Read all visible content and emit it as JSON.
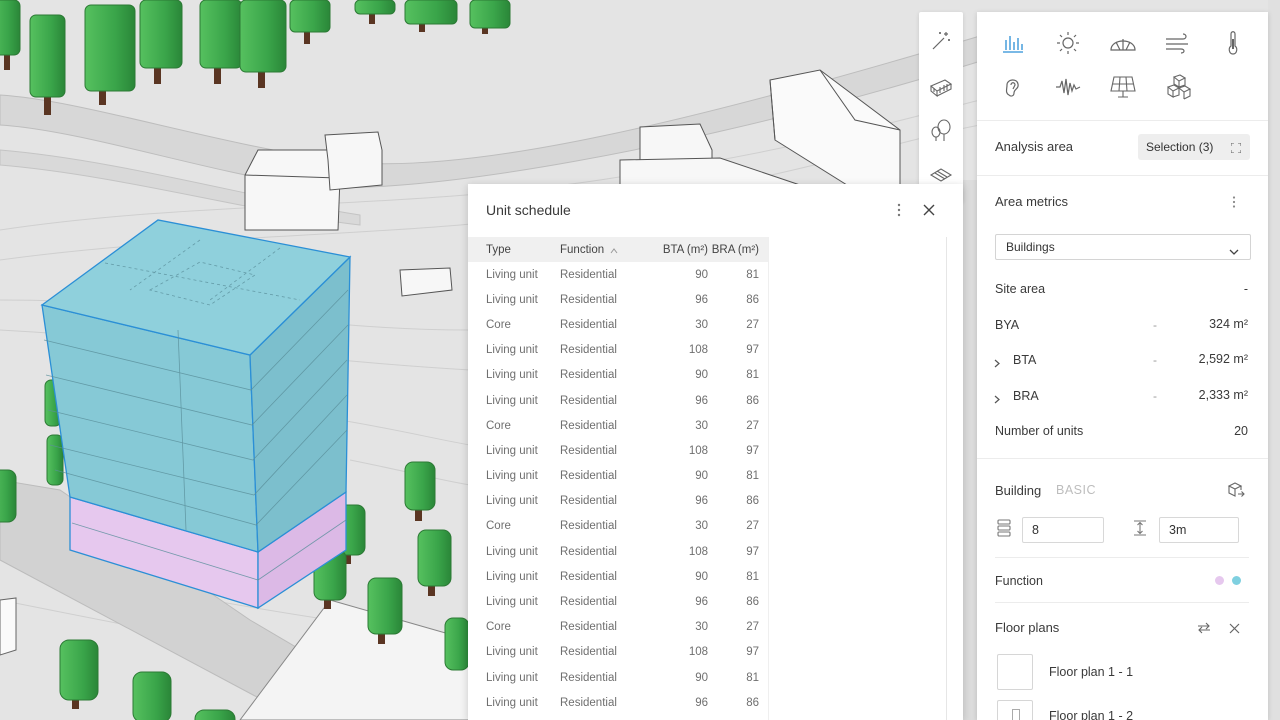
{
  "toolbar": {
    "tools": [
      {
        "icon": "magic-wand-icon"
      },
      {
        "icon": "building-block-icon"
      },
      {
        "icon": "trees-icon"
      },
      {
        "icon": "plane-icon"
      }
    ]
  },
  "unit_schedule": {
    "title": "Unit schedule",
    "columns": {
      "type": "Type",
      "function": "Function",
      "bta": "BTA (m²)",
      "bra": "BRA (m²)"
    },
    "sort_indicator": "^",
    "rows": [
      {
        "type": "Living unit",
        "function": "Residential",
        "bta": "90",
        "bra": "81"
      },
      {
        "type": "Living unit",
        "function": "Residential",
        "bta": "96",
        "bra": "86"
      },
      {
        "type": "Core",
        "function": "Residential",
        "bta": "30",
        "bra": "27"
      },
      {
        "type": "Living unit",
        "function": "Residential",
        "bta": "108",
        "bra": "97"
      },
      {
        "type": "Living unit",
        "function": "Residential",
        "bta": "90",
        "bra": "81"
      },
      {
        "type": "Living unit",
        "function": "Residential",
        "bta": "96",
        "bra": "86"
      },
      {
        "type": "Core",
        "function": "Residential",
        "bta": "30",
        "bra": "27"
      },
      {
        "type": "Living unit",
        "function": "Residential",
        "bta": "108",
        "bra": "97"
      },
      {
        "type": "Living unit",
        "function": "Residential",
        "bta": "90",
        "bra": "81"
      },
      {
        "type": "Living unit",
        "function": "Residential",
        "bta": "96",
        "bra": "86"
      },
      {
        "type": "Core",
        "function": "Residential",
        "bta": "30",
        "bra": "27"
      },
      {
        "type": "Living unit",
        "function": "Residential",
        "bta": "108",
        "bra": "97"
      },
      {
        "type": "Living unit",
        "function": "Residential",
        "bta": "90",
        "bra": "81"
      },
      {
        "type": "Living unit",
        "function": "Residential",
        "bta": "96",
        "bra": "86"
      },
      {
        "type": "Core",
        "function": "Residential",
        "bta": "30",
        "bra": "27"
      },
      {
        "type": "Living unit",
        "function": "Residential",
        "bta": "108",
        "bra": "97"
      },
      {
        "type": "Living unit",
        "function": "Residential",
        "bta": "90",
        "bra": "81"
      },
      {
        "type": "Living unit",
        "function": "Residential",
        "bta": "96",
        "bra": "86"
      }
    ]
  },
  "panel": {
    "analysis_icons": [
      "bar-chart-icon",
      "sun-icon",
      "daylight-dome-icon",
      "wind-icon",
      "thermometer-icon",
      "ear-noise-icon",
      "soundwave-icon",
      "solar-panel-icon",
      "volumes-icon"
    ],
    "analysis_area": {
      "label": "Analysis area",
      "selection": "Selection (3)"
    },
    "area_metrics": {
      "title": "Area metrics",
      "dropdown": "Buildings",
      "site_area": {
        "label": "Site area",
        "value": "-"
      },
      "bya": {
        "label": "BYA",
        "dash": "-",
        "value": "324 m²"
      },
      "bta": {
        "label": "BTA",
        "dash": "-",
        "value": "2,592 m²"
      },
      "bra": {
        "label": "BRA",
        "dash": "-",
        "value": "2,333 m²"
      },
      "units": {
        "label": "Number of units",
        "value": "20"
      }
    },
    "building": {
      "title": "Building",
      "tag": "BASIC",
      "floors": "8",
      "floor_height": "3m",
      "function_label": "Function",
      "function_colors": [
        "#e6c8ee",
        "#7fd0e0"
      ]
    },
    "floor_plans": {
      "title": "Floor plans",
      "items": [
        "Floor plan 1 - 1",
        "Floor plan 1 - 2"
      ]
    }
  },
  "colors": {
    "accent": "#2b8fd6",
    "glass": "#86c9d6",
    "residential_pink": "#e6c8ee",
    "tree_green": "#3aa54a"
  }
}
